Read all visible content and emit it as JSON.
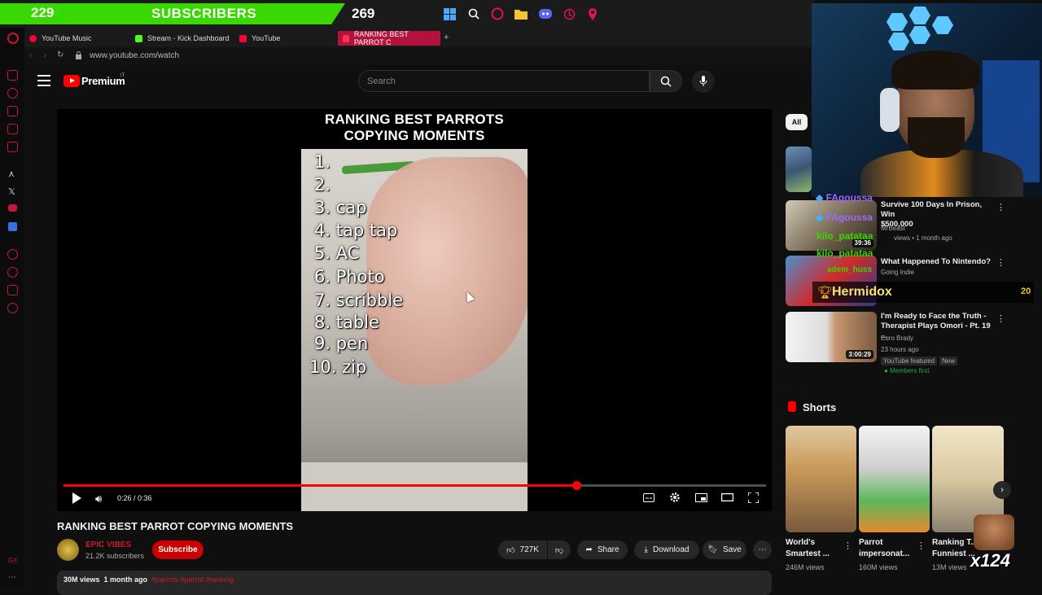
{
  "overlay": {
    "sub_count_left": "229",
    "sub_label": "SUBSCRIBERS",
    "sub_count_right": "269"
  },
  "browser": {
    "tabs": [
      {
        "label": "YouTube Music",
        "color": "#ff0033"
      },
      {
        "label": "Stream - Kick Dashboard",
        "color": "#53fc18"
      },
      {
        "label": "YouTube",
        "color": "#ff0033"
      },
      {
        "label": "RANKING BEST PARROT C",
        "color": "#ff0033"
      }
    ],
    "new_tab": "+",
    "url": "www.youtube.com/watch"
  },
  "header": {
    "logo_text": "Premium",
    "region": "IT",
    "search_placeholder": "Search"
  },
  "player": {
    "title_line1": "RANKING BEST PARROTS",
    "title_line2": "COPYING MOMENTS",
    "ranks": [
      "1.",
      "2.",
      "3. cap",
      "4. tap tap",
      "5. AC",
      "6. Photo",
      "7. scribble",
      "8. table",
      "9. pen",
      "10. zip"
    ],
    "timecode": "0:26 / 0:36",
    "progress": 0.73
  },
  "video": {
    "title": "RANKING BEST PARROT COPYING MOMENTS",
    "channel_name": "EPIC VIBES",
    "channel_subs": "21.2K subscribers",
    "subscribe_label": "Subscribe",
    "likes": "727K",
    "share_label": "Share",
    "download_label": "Download",
    "save_label": "Save",
    "views": "30M views",
    "age": "1 month ago",
    "hashtags": "#parrots #parrot #ranking"
  },
  "sidebar": {
    "chip_all": "All",
    "recs": [
      {
        "title_line1": "Survive 100 Days In Prison, Win",
        "title_line2": "$500,000",
        "channel": "MrBeast",
        "meta": "views • 1 month ago",
        "duration": "39:36"
      },
      {
        "title_line1": "What Happened To Nintendo?",
        "title_line2": "",
        "channel": "Going Indie",
        "meta": "",
        "duration": ""
      },
      {
        "title_line1": "I'm Ready to Face the Truth -",
        "title_line2": "Therapist Plays Omori - Pt. 19 ...",
        "channel": "Euro Brady",
        "meta": "23 hours ago",
        "badge1": "YouTube featured",
        "badge2": "New",
        "members": "Members first",
        "duration": "3:00:29"
      }
    ],
    "shorts_label": "Shorts",
    "shorts": [
      {
        "title_line1": "World's",
        "title_line2": "Smartest ...",
        "views": "246M views"
      },
      {
        "title_line1": "Parrot",
        "title_line2": "impersonat...",
        "views": "160M views"
      },
      {
        "title_line1": "Ranking T...",
        "title_line2": "Funniest ...",
        "views": "13M views"
      }
    ]
  },
  "chat": {
    "messages": [
      {
        "name": "FAgoussa",
        "color": "#9b6bff"
      },
      {
        "name": "FAgoussa",
        "color": "#9b6bff"
      },
      {
        "name": "kilo_patataa",
        "color": "#39d800"
      },
      {
        "name": "kilo_patataa",
        "color": "#39d800"
      },
      {
        "name": "adem_huss",
        "color": "#39d800"
      }
    ],
    "leader_name": "Hermidox",
    "leader_score": "20",
    "combo": "x124"
  }
}
